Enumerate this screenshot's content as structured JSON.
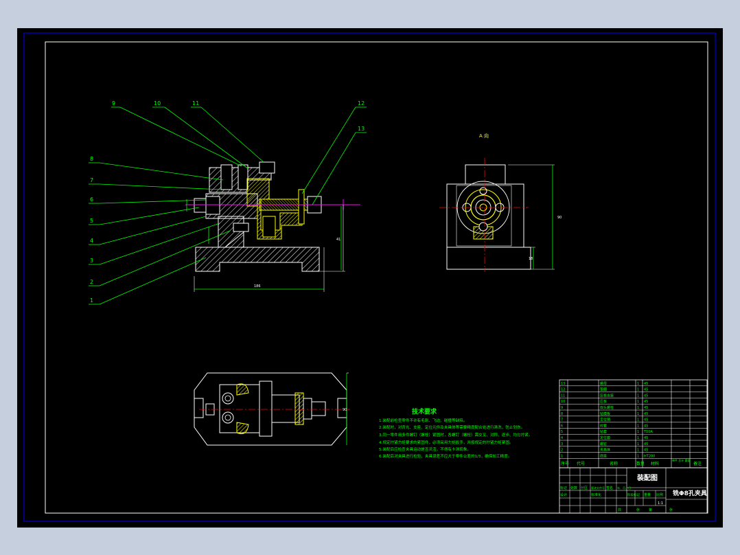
{
  "view_label": "A 向",
  "leaders": [
    "9",
    "10",
    "11",
    "12",
    "13",
    "8",
    "7",
    "6",
    "5",
    "4",
    "3",
    "2",
    "1"
  ],
  "dims": {
    "overall_length": "186",
    "height_side": "41",
    "height_end": "90",
    "height_end_small": "18",
    "plan_height": "90"
  },
  "tech_req": {
    "title": "技术要求",
    "items": [
      "1.装配前检查零件不许有毛刺、飞边、碰撞等缺陷。",
      "2.装配时，对背光、支座、定位元件及夹具体等需要精度配合处进行清洗，防止划伤。",
      "3.同一零件用多件螺钉（螺栓）紧固时，各螺钉（螺栓）需交叉、对称、逐步、均匀拧紧。",
      "4.规定拧紧力矩要求的紧固件，必须采用力矩扳手，并按规定的拧紧力矩紧固。",
      "5.装配后应检查夹具运动是否灵活，不得有卡滞现象。",
      "6.装配后对夹具进行检验，夹具误差不应大于零件公差的1/3，确保加工精度。"
    ]
  },
  "title_block": {
    "drawing_type": "装配图",
    "drawing_name": "铣Φ8孔夹具",
    "scale": "1:1",
    "header_cols": [
      "序号",
      "代号",
      "名称",
      "数量",
      "材料",
      "单件 总计 重量",
      "备注"
    ],
    "bottom_labels": [
      "标记",
      "处数",
      "分区",
      "更改文件号",
      "签名",
      "年、月、日"
    ],
    "mid_labels": [
      "设计",
      "标准化",
      "阶段标记",
      "重量",
      "比例"
    ],
    "sheet_labels": [
      "共",
      "张",
      "第",
      "张"
    ]
  },
  "parts": [
    {
      "no": "13",
      "name": "螺母",
      "qty": "1",
      "mat": "45"
    },
    {
      "no": "12",
      "name": "垫圈",
      "qty": "1",
      "mat": "45"
    },
    {
      "no": "11",
      "name": "压板支座",
      "qty": "1",
      "mat": "45"
    },
    {
      "no": "10",
      "name": "压板",
      "qty": "1",
      "mat": "45"
    },
    {
      "no": "9",
      "name": "双头螺柱",
      "qty": "1",
      "mat": "45"
    },
    {
      "no": "8",
      "name": "钻模板",
      "qty": "1",
      "mat": "45"
    },
    {
      "no": "7",
      "name": "定位销",
      "qty": "1",
      "mat": "45"
    },
    {
      "no": "6",
      "name": "衬套",
      "qty": "1",
      "mat": "45"
    },
    {
      "no": "5",
      "name": "钻套",
      "qty": "1",
      "mat": "T10A"
    },
    {
      "no": "4",
      "name": "定位套",
      "qty": "1",
      "mat": "45"
    },
    {
      "no": "3",
      "name": "螺钉",
      "qty": "1",
      "mat": "45"
    },
    {
      "no": "2",
      "name": "夹具体",
      "qty": "1",
      "mat": "45"
    },
    {
      "no": "1",
      "name": "底座",
      "qty": "1",
      "mat": "HT200"
    }
  ],
  "colors": {
    "page_bg": "#c5cfdd",
    "frame_outer": "#0000ff",
    "frame_inner": "#ffffff",
    "line": "#ffffff",
    "leader": "#00ff00",
    "dim": "#00ff00",
    "hatch": "#ffff00",
    "center": "#ff0000",
    "magenta": "#ff00ff",
    "table_line": "#00ff00"
  }
}
